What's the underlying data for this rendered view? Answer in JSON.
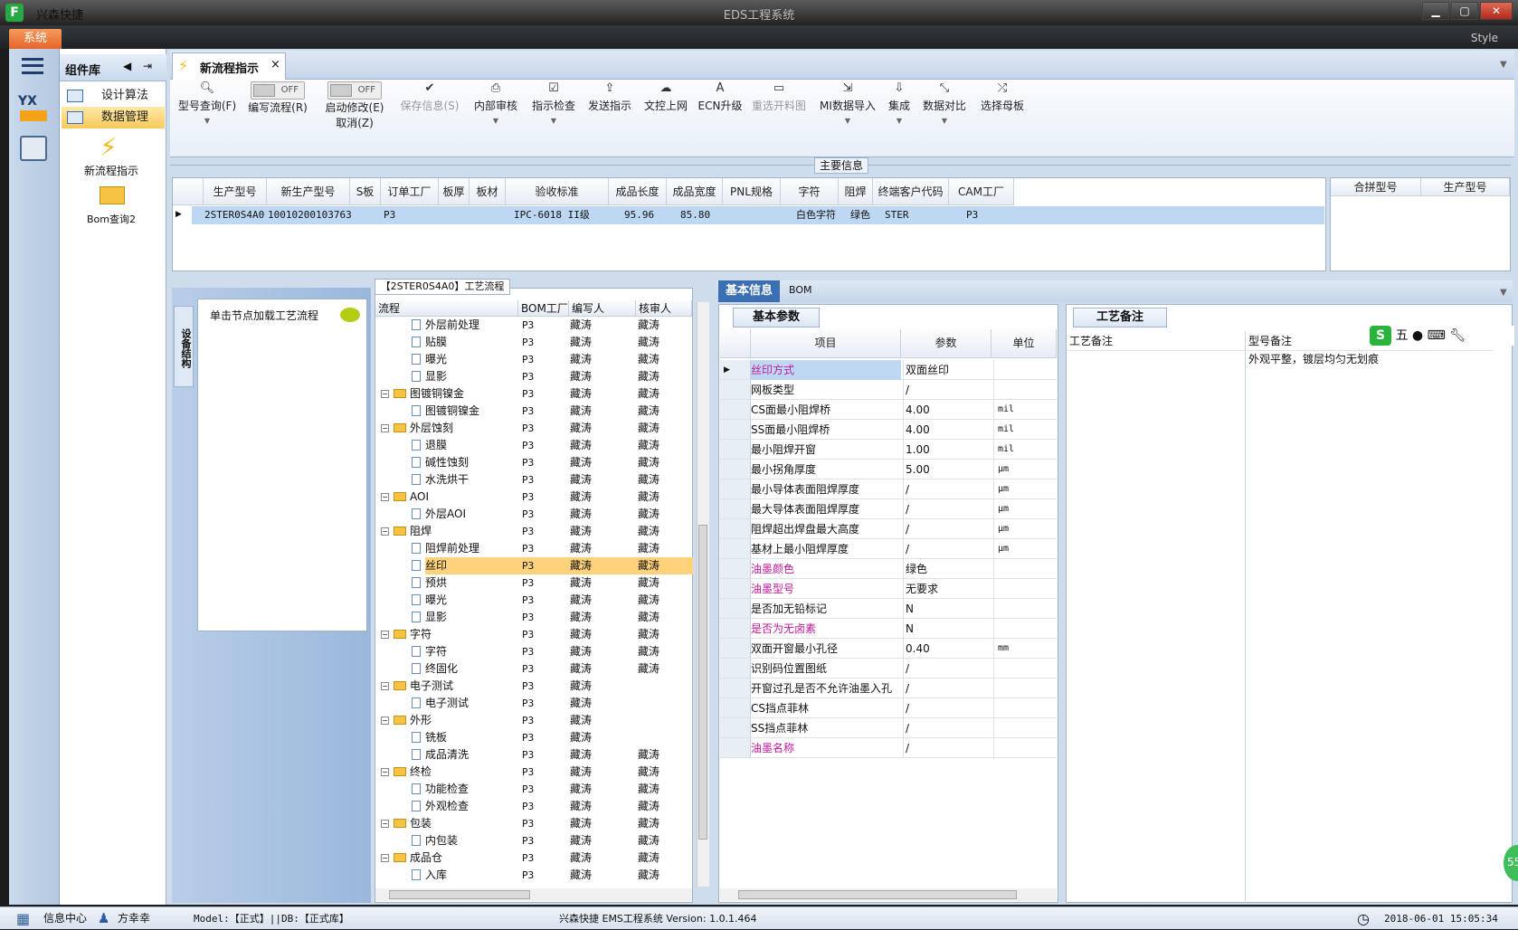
{
  "titlebar": {
    "app_name": "兴森快捷",
    "window_title": "EDS工程系统",
    "min": "▁",
    "max": "▢",
    "close": "✕"
  },
  "menubar": {
    "system": "系统",
    "style": "Style"
  },
  "leftbar": {
    "logo_text": "YX"
  },
  "component_panel": {
    "title": "组件库",
    "items": [
      {
        "label": "设计算法"
      },
      {
        "label": "数据管理"
      }
    ],
    "shortcuts": [
      {
        "label": "新流程指示"
      },
      {
        "label": "Bom查询2"
      }
    ]
  },
  "tab": {
    "label": "新流程指示",
    "close": "×"
  },
  "toolbar": {
    "query": "型号查询(F)",
    "edit_flow": "编写流程(R)",
    "start_modify": "启动修改(E)",
    "cancel": "取消(Z)",
    "toggle_off": "OFF",
    "save": "保存信息(S)",
    "internal_review": "内部审核",
    "instruction_check": "指示检查",
    "send_instruction": "发送指示",
    "file_upload": "文控上网",
    "ecn_upgrade": "ECN升级",
    "reselect_map": "重选开料图",
    "mi_import": "MI数据导入",
    "integrate": "集成",
    "data_compare": "数据对比",
    "select_mother": "选择母板"
  },
  "main_info": {
    "label": "主要信息",
    "columns": [
      "生产型号",
      "新生产型号",
      "S板",
      "订单工厂",
      "板厚",
      "板材",
      "验收标准",
      "成品长度",
      "成品宽度",
      "PNL规格",
      "字符",
      "阻焊",
      "终端客户代码",
      "CAM工厂"
    ],
    "row": [
      "2STER0S4A0",
      "10010200103763",
      "",
      "P3",
      "",
      "",
      "IPC-6018 II级",
      "95.96",
      "85.80",
      "",
      "白色字符",
      "绿色",
      "STER",
      "P3"
    ],
    "side_columns": [
      "合拼型号",
      "生产型号"
    ]
  },
  "equipment": {
    "vtab": "设备结构",
    "hint": "单击节点加载工艺流程"
  },
  "process": {
    "title": "【2STER0S4A0】工艺流程",
    "columns": [
      "流程",
      "BOM工厂",
      "编写人",
      "核审人"
    ],
    "rows": [
      {
        "name": "外层前处理",
        "level": 2,
        "factory": "P3",
        "writer": "藏涛",
        "reviewer": "藏涛"
      },
      {
        "name": "贴膜",
        "level": 2,
        "factory": "P3",
        "writer": "藏涛",
        "reviewer": "藏涛"
      },
      {
        "name": "曝光",
        "level": 2,
        "factory": "P3",
        "writer": "藏涛",
        "reviewer": "藏涛"
      },
      {
        "name": "显影",
        "level": 2,
        "factory": "P3",
        "writer": "藏涛",
        "reviewer": "藏涛"
      },
      {
        "name": "图镀铜镍金",
        "level": 1,
        "factory": "P3",
        "writer": "藏涛",
        "reviewer": "藏涛"
      },
      {
        "name": "图镀铜镍金",
        "level": 2,
        "factory": "P3",
        "writer": "藏涛",
        "reviewer": "藏涛"
      },
      {
        "name": "外层蚀刻",
        "level": 1,
        "factory": "P3",
        "writer": "藏涛",
        "reviewer": "藏涛"
      },
      {
        "name": "退膜",
        "level": 2,
        "factory": "P3",
        "writer": "藏涛",
        "reviewer": "藏涛"
      },
      {
        "name": "碱性蚀刻",
        "level": 2,
        "factory": "P3",
        "writer": "藏涛",
        "reviewer": "藏涛"
      },
      {
        "name": "水洗烘干",
        "level": 2,
        "factory": "P3",
        "writer": "藏涛",
        "reviewer": "藏涛"
      },
      {
        "name": "AOI",
        "level": 1,
        "factory": "P3",
        "writer": "藏涛",
        "reviewer": "藏涛"
      },
      {
        "name": "外层AOI",
        "level": 2,
        "factory": "P3",
        "writer": "藏涛",
        "reviewer": "藏涛"
      },
      {
        "name": "阻焊",
        "level": 1,
        "factory": "P3",
        "writer": "藏涛",
        "reviewer": "藏涛"
      },
      {
        "name": "阻焊前处理",
        "level": 2,
        "factory": "P3",
        "writer": "藏涛",
        "reviewer": "藏涛"
      },
      {
        "name": "丝印",
        "level": 2,
        "factory": "P3",
        "writer": "藏涛",
        "reviewer": "藏涛"
      },
      {
        "name": "预烘",
        "level": 2,
        "factory": "P3",
        "writer": "藏涛",
        "reviewer": "藏涛"
      },
      {
        "name": "曝光",
        "level": 2,
        "factory": "P3",
        "writer": "藏涛",
        "reviewer": "藏涛"
      },
      {
        "name": "显影",
        "level": 2,
        "factory": "P3",
        "writer": "藏涛",
        "reviewer": "藏涛"
      },
      {
        "name": "字符",
        "level": 1,
        "factory": "P3",
        "writer": "藏涛",
        "reviewer": "藏涛"
      },
      {
        "name": "字符",
        "level": 2,
        "factory": "P3",
        "writer": "藏涛",
        "reviewer": "藏涛"
      },
      {
        "name": "终固化",
        "level": 2,
        "factory": "P3",
        "writer": "藏涛",
        "reviewer": "藏涛"
      },
      {
        "name": "电子测试",
        "level": 1,
        "factory": "P3",
        "writer": "藏涛",
        "reviewer": ""
      },
      {
        "name": "电子测试",
        "level": 2,
        "factory": "P3",
        "writer": "藏涛",
        "reviewer": ""
      },
      {
        "name": "外形",
        "level": 1,
        "factory": "P3",
        "writer": "藏涛",
        "reviewer": ""
      },
      {
        "name": "铣板",
        "level": 2,
        "factory": "P3",
        "writer": "藏涛",
        "reviewer": ""
      },
      {
        "name": "成品清洗",
        "level": 2,
        "factory": "P3",
        "writer": "藏涛",
        "reviewer": "藏涛"
      },
      {
        "name": "终检",
        "level": 1,
        "factory": "P3",
        "writer": "藏涛",
        "reviewer": "藏涛"
      },
      {
        "name": "功能检查",
        "level": 2,
        "factory": "P3",
        "writer": "藏涛",
        "reviewer": "藏涛"
      },
      {
        "name": "外观检查",
        "level": 2,
        "factory": "P3",
        "writer": "藏涛",
        "reviewer": "藏涛"
      },
      {
        "name": "包装",
        "level": 1,
        "factory": "P3",
        "writer": "藏涛",
        "reviewer": "藏涛"
      },
      {
        "name": "内包装",
        "level": 2,
        "factory": "P3",
        "writer": "藏涛",
        "reviewer": "藏涛"
      },
      {
        "name": "成品仓",
        "level": 1,
        "factory": "P3",
        "writer": "藏涛",
        "reviewer": "藏涛"
      },
      {
        "name": "入库",
        "level": 2,
        "factory": "P3",
        "writer": "藏涛",
        "reviewer": "藏涛"
      }
    ],
    "selected_index": 14
  },
  "right_tabs": {
    "basic": "基本信息",
    "bom": "BOM"
  },
  "params": {
    "tab": "基本参数",
    "columns": [
      "项目",
      "参数",
      "单位"
    ],
    "rows": [
      {
        "item": "丝印方式",
        "value": "双面丝印",
        "unit": "",
        "highlight": true
      },
      {
        "item": "网板类型",
        "value": "/",
        "unit": "",
        "highlight": false
      },
      {
        "item": "CS面最小阻焊桥",
        "value": "4.00",
        "unit": "mil",
        "highlight": false
      },
      {
        "item": "SS面最小阻焊桥",
        "value": "4.00",
        "unit": "mil",
        "highlight": false
      },
      {
        "item": "最小阻焊开窗",
        "value": "1.00",
        "unit": "mil",
        "highlight": false
      },
      {
        "item": "最小拐角厚度",
        "value": "5.00",
        "unit": "μm",
        "highlight": false
      },
      {
        "item": "最小导体表面阻焊厚度",
        "value": "/",
        "unit": "μm",
        "highlight": false
      },
      {
        "item": "最大导体表面阻焊厚度",
        "value": "/",
        "unit": "μm",
        "highlight": false
      },
      {
        "item": "阻焊超出焊盘最大高度",
        "value": "/",
        "unit": "μm",
        "highlight": false
      },
      {
        "item": "基材上最小阻焊厚度",
        "value": "/",
        "unit": "μm",
        "highlight": false
      },
      {
        "item": "油墨颜色",
        "value": "绿色",
        "unit": "",
        "highlight": true
      },
      {
        "item": "油墨型号",
        "value": "无要求",
        "unit": "",
        "highlight": true
      },
      {
        "item": "是否加无铅标记",
        "value": "N",
        "unit": "",
        "highlight": false
      },
      {
        "item": "是否为无卤素",
        "value": "N",
        "unit": "",
        "highlight": true
      },
      {
        "item": "双面开窗最小孔径",
        "value": "0.40",
        "unit": "mm",
        "highlight": false
      },
      {
        "item": "识别码位置图纸",
        "value": "/",
        "unit": "",
        "highlight": false
      },
      {
        "item": "开窗过孔是否不允许油墨入孔",
        "value": "/",
        "unit": "",
        "highlight": false
      },
      {
        "item": "CS挡点菲林",
        "value": "/",
        "unit": "",
        "highlight": false
      },
      {
        "item": "SS挡点菲林",
        "value": "/",
        "unit": "",
        "highlight": false
      },
      {
        "item": "油墨名称",
        "value": "/",
        "unit": "",
        "highlight": true
      }
    ]
  },
  "notes": {
    "tab": "工艺备注",
    "col1": "工艺备注",
    "col2": "型号备注",
    "text": "外观平整，镀层均匀无划痕",
    "ime_s": "S",
    "ime_mode": "五"
  },
  "status": {
    "info_center": "信息中心",
    "user": "方幸幸",
    "model": "Model:【正式】||DB:【正式库】",
    "system": "兴森快捷 EMS工程系统 Version: 1.0.1.464",
    "datetime": "2018-06-01 15:05:34",
    "ball": "55"
  },
  "colors": {
    "accent": "#3b6fb3",
    "highlight_text": "#c0189a",
    "selected_row": "#fdd27a",
    "system_menu": "#e5652b"
  }
}
